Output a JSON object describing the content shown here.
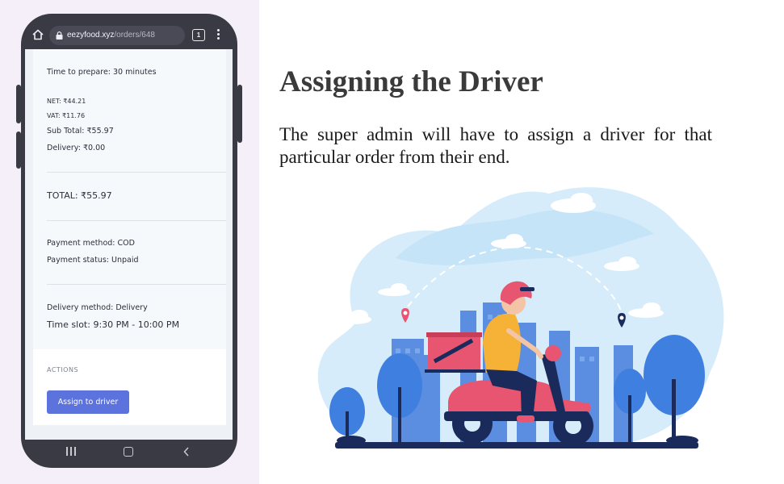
{
  "browser": {
    "url_domain": "eezyfood.xyz",
    "url_path": "/orders/648",
    "tab_count": "1"
  },
  "order": {
    "time_to_prepare": "Time to prepare: 30 minutes",
    "net": "NET: ₹44.21",
    "vat": "VAT: ₹11.76",
    "sub_total": "Sub Total: ₹55.97",
    "delivery": "Delivery: ₹0.00",
    "total": "TOTAL: ₹55.97",
    "payment_method": "Payment method: COD",
    "payment_status": "Payment status: Unpaid",
    "delivery_method": "Delivery method: Delivery",
    "time_slot": "Time slot: 9:30 PM - 10:00 PM"
  },
  "actions": {
    "label": "ACTIONS",
    "assign_button": "Assign to driver"
  },
  "slide": {
    "heading": "Assigning the Driver",
    "description": "The super admin will have to assign a driver for that particular order from their end."
  },
  "colors": {
    "accent_button": "#5c72dc",
    "left_background": "#f4eff8",
    "phone_frame": "#3a3a44"
  },
  "icons": [
    "home-icon",
    "lock-icon",
    "tabs-icon",
    "menu-icon",
    "nav-recent-icon",
    "nav-home-icon",
    "nav-back-icon",
    "location-pin-icon"
  ]
}
